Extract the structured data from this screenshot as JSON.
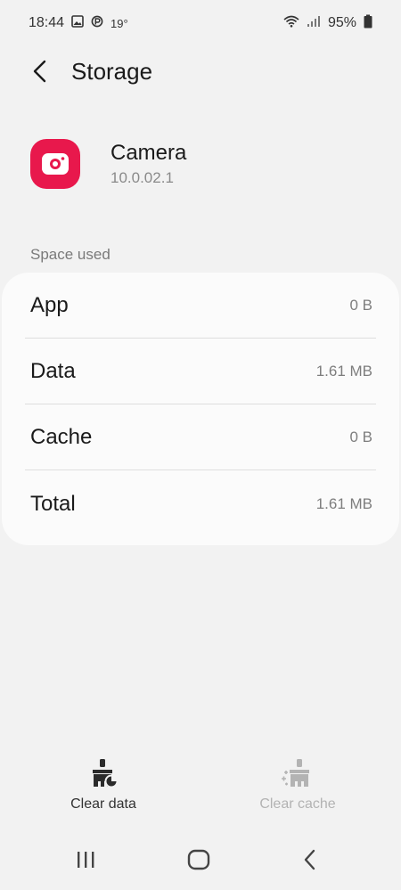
{
  "status_bar": {
    "time": "18:44",
    "temperature": "19°",
    "battery": "95%",
    "icons": [
      "image-icon",
      "app-p-icon",
      "wifi-icon",
      "signal-icon",
      "battery-icon"
    ]
  },
  "header": {
    "title": "Storage",
    "back_icon": "back-arrow-icon"
  },
  "app": {
    "name": "Camera",
    "version": "10.0.02.1",
    "icon": "camera-app-icon",
    "icon_color": "#e8184c"
  },
  "space_used": {
    "label": "Space used",
    "rows": [
      {
        "label": "App",
        "value": "0 B"
      },
      {
        "label": "Data",
        "value": "1.61 MB"
      },
      {
        "label": "Cache",
        "value": "0 B"
      },
      {
        "label": "Total",
        "value": "1.61 MB"
      }
    ]
  },
  "actions": {
    "clear_data": {
      "label": "Clear data",
      "icon": "clear-data-icon",
      "enabled": true
    },
    "clear_cache": {
      "label": "Clear cache",
      "icon": "clear-cache-icon",
      "enabled": false
    }
  },
  "navbar": {
    "icons": [
      "recent-apps-icon",
      "home-icon",
      "nav-back-icon"
    ]
  }
}
